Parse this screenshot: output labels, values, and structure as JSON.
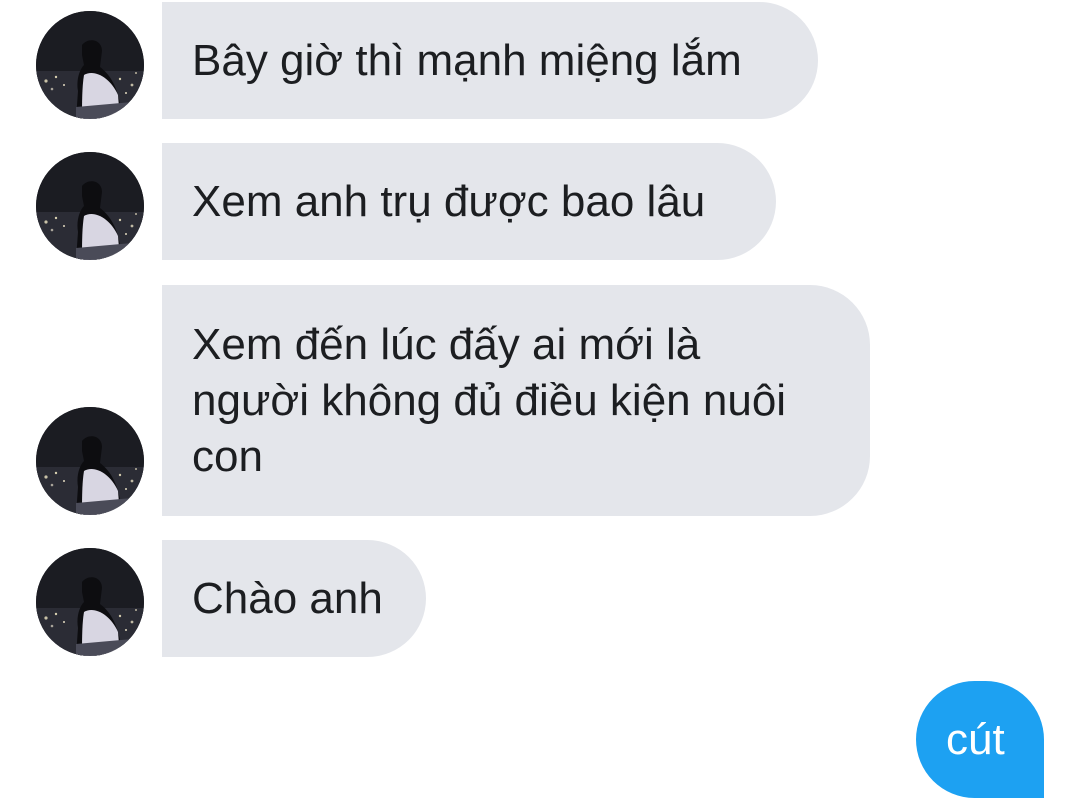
{
  "conversation": {
    "incoming": [
      {
        "text": "Bây giờ thì mạnh miệng lắm"
      },
      {
        "text": "Xem anh trụ được bao lâu"
      },
      {
        "text": "Xem đến lúc đấy ai mới là\nngười không đủ điều kiện nuôi\ncon"
      },
      {
        "text": "Chào anh"
      }
    ],
    "outgoing": [
      {
        "text": "cút"
      }
    ]
  },
  "colors": {
    "incoming_bubble": "#e4e6eb",
    "outgoing_bubble": "#1da1f2",
    "incoming_text": "#1c1e21",
    "outgoing_text": "#ffffff"
  },
  "icons": {
    "avatar": "contact-avatar-photo"
  }
}
